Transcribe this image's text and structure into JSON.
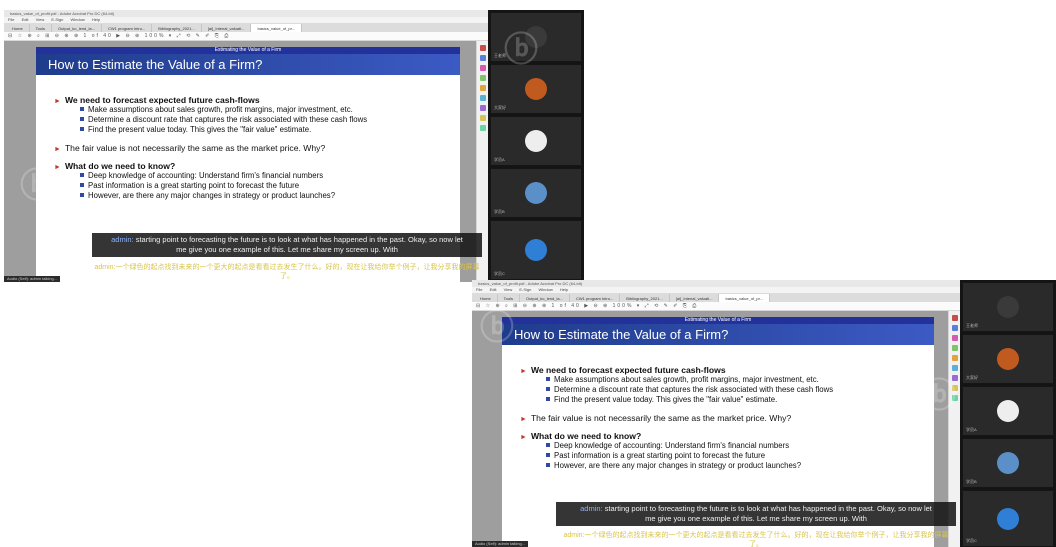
{
  "window": {
    "title": "basics_value_of_profit.pdf - Adobe Acrobat Pro DC (64-bit)",
    "menu": [
      "File",
      "Edit",
      "View",
      "E-Sign",
      "Window",
      "Help"
    ],
    "tabs": [
      "Home",
      "Tools",
      "Output_ko_lend_la...",
      "CW1 program Intro...",
      "Bibliography_2021...",
      "[ai]_Intenal_valuati...",
      "basics_value_of_pr..."
    ],
    "toolbar_icons": "⊟ ☆ ⊕ ⌕     ⊞ ⊖ ⊕ ⊕ 1 of 40   ▶ ⊖ ⊕ 100% ▾  ⤢ ⟲ ✎ ✐ ⎘ ⎙"
  },
  "slide": {
    "header": "Estimating the Value of a Firm",
    "title": "How to Estimate the Value of a Firm?",
    "sections": [
      {
        "text": "We need to forecast expected future cash-flows",
        "bold": true,
        "items": [
          "Make assumptions about sales growth, profit margins, major investment, etc.",
          "Determine a discount rate that captures the risk associated with these cash flows",
          "Find the present value today. This gives the \"fair value\" estimate."
        ]
      },
      {
        "text": "The fair value is not necessarily the same as the market price. Why?",
        "bold": false,
        "items": []
      },
      {
        "text": "What do we need to know?",
        "bold": true,
        "items": [
          "Deep knowledge of accounting: Understand firm's financial numbers",
          "Past information is a great starting point to forecast the future",
          "However, are there any major changes in strategy or product launches?"
        ]
      }
    ]
  },
  "caption": {
    "speaker": "admin:",
    "line1": " starting point to forecasting the future is to look at what has happened in the past. Okay, so now let",
    "line2": "me give you one example of this. Let me share my screen up. With",
    "translation": "admin:一个绿色的起点找到未来的一个更大的起点是看看过去发生了什么。好的，现在让我给你举个例子，让我分享我的屏幕了。"
  },
  "status_text": "Audio (Self): admin talking...",
  "participants": [
    {
      "name": "王老师",
      "avatar": "#3a3a3a"
    },
    {
      "name": "大家好",
      "avatar": "#c05a1e"
    },
    {
      "name": "学员A",
      "avatar": "#eeeeee"
    },
    {
      "name": "学员B",
      "avatar": "#5b8fc7"
    },
    {
      "name": "学员C",
      "avatar": "#2f7fd6"
    }
  ],
  "colors": {
    "slide_header": "#23329a",
    "title_bar": "#2f4bb0",
    "bullet_arrow": "#c0392b",
    "caption_bg": "#141414"
  }
}
